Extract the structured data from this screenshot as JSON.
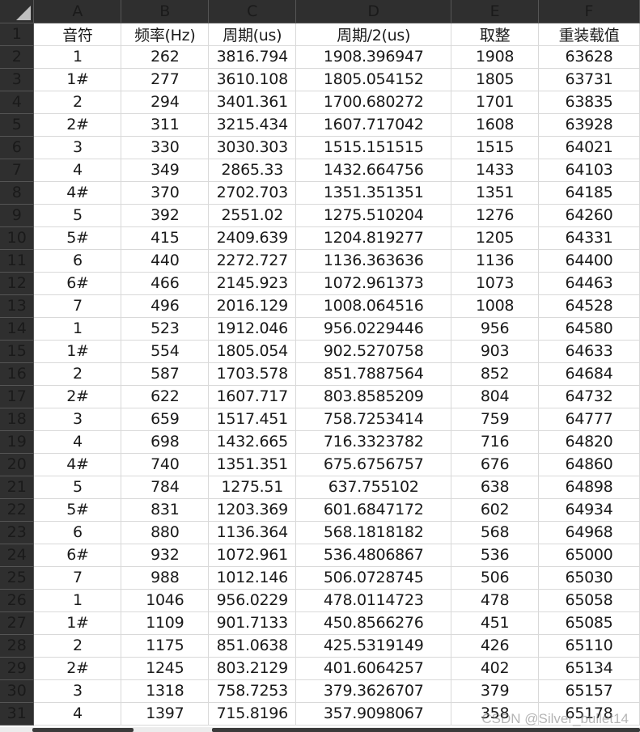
{
  "columns": [
    "A",
    "B",
    "C",
    "D",
    "E",
    "F"
  ],
  "rows": [
    [
      "1",
      "音符",
      "频率(Hz)",
      "周期(us)",
      "周期/2(us)",
      "取整",
      "重装载值"
    ],
    [
      "2",
      "1",
      "262",
      "3816.794",
      "1908.396947",
      "1908",
      "63628"
    ],
    [
      "3",
      "1#",
      "277",
      "3610.108",
      "1805.054152",
      "1805",
      "63731"
    ],
    [
      "4",
      "2",
      "294",
      "3401.361",
      "1700.680272",
      "1701",
      "63835"
    ],
    [
      "5",
      "2#",
      "311",
      "3215.434",
      "1607.717042",
      "1608",
      "63928"
    ],
    [
      "6",
      "3",
      "330",
      "3030.303",
      "1515.151515",
      "1515",
      "64021"
    ],
    [
      "7",
      "4",
      "349",
      "2865.33",
      "1432.664756",
      "1433",
      "64103"
    ],
    [
      "8",
      "4#",
      "370",
      "2702.703",
      "1351.351351",
      "1351",
      "64185"
    ],
    [
      "9",
      "5",
      "392",
      "2551.02",
      "1275.510204",
      "1276",
      "64260"
    ],
    [
      "10",
      "5#",
      "415",
      "2409.639",
      "1204.819277",
      "1205",
      "64331"
    ],
    [
      "11",
      "6",
      "440",
      "2272.727",
      "1136.363636",
      "1136",
      "64400"
    ],
    [
      "12",
      "6#",
      "466",
      "2145.923",
      "1072.961373",
      "1073",
      "64463"
    ],
    [
      "13",
      "7",
      "496",
      "2016.129",
      "1008.064516",
      "1008",
      "64528"
    ],
    [
      "14",
      "1",
      "523",
      "1912.046",
      "956.0229446",
      "956",
      "64580"
    ],
    [
      "15",
      "1#",
      "554",
      "1805.054",
      "902.5270758",
      "903",
      "64633"
    ],
    [
      "16",
      "2",
      "587",
      "1703.578",
      "851.7887564",
      "852",
      "64684"
    ],
    [
      "17",
      "2#",
      "622",
      "1607.717",
      "803.8585209",
      "804",
      "64732"
    ],
    [
      "18",
      "3",
      "659",
      "1517.451",
      "758.7253414",
      "759",
      "64777"
    ],
    [
      "19",
      "4",
      "698",
      "1432.665",
      "716.3323782",
      "716",
      "64820"
    ],
    [
      "20",
      "4#",
      "740",
      "1351.351",
      "675.6756757",
      "676",
      "64860"
    ],
    [
      "21",
      "5",
      "784",
      "1275.51",
      "637.755102",
      "638",
      "64898"
    ],
    [
      "22",
      "5#",
      "831",
      "1203.369",
      "601.6847172",
      "602",
      "64934"
    ],
    [
      "23",
      "6",
      "880",
      "1136.364",
      "568.1818182",
      "568",
      "64968"
    ],
    [
      "24",
      "6#",
      "932",
      "1072.961",
      "536.4806867",
      "536",
      "65000"
    ],
    [
      "25",
      "7",
      "988",
      "1012.146",
      "506.0728745",
      "506",
      "65030"
    ],
    [
      "26",
      "1",
      "1046",
      "956.0229",
      "478.0114723",
      "478",
      "65058"
    ],
    [
      "27",
      "1#",
      "1109",
      "901.7133",
      "450.8566276",
      "451",
      "65085"
    ],
    [
      "28",
      "2",
      "1175",
      "851.0638",
      "425.5319149",
      "426",
      "65110"
    ],
    [
      "29",
      "2#",
      "1245",
      "803.2129",
      "401.6064257",
      "402",
      "65134"
    ],
    [
      "30",
      "3",
      "1318",
      "758.7253",
      "379.3626707",
      "379",
      "65157"
    ],
    [
      "31",
      "4",
      "1397",
      "715.8196",
      "357.9098067",
      "358",
      "65178"
    ]
  ],
  "watermark": "CSDN @Silver_bullet14"
}
